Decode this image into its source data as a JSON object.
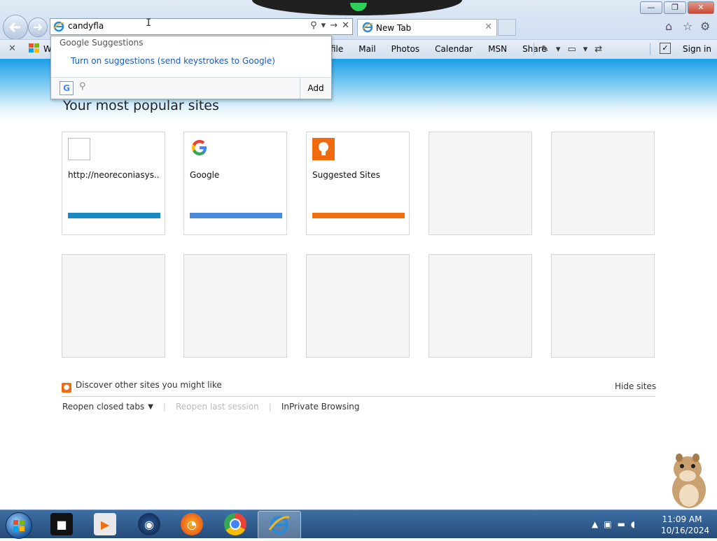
{
  "browser": {
    "address_value": "candyfla",
    "tab_label": "New Tab",
    "window_buttons": {
      "minimize": "—",
      "restore": "❐",
      "close": "✕"
    },
    "address_actions": {
      "search": "⚲",
      "dropdown": "▾",
      "go": "→",
      "stop": "✕"
    }
  },
  "favorites_bar": {
    "left_partial": "W",
    "links": [
      "file",
      "Mail",
      "Photos",
      "Calendar",
      "MSN",
      "Share"
    ],
    "sign_in": "Sign in"
  },
  "suggestions": {
    "header": "Google Suggestions",
    "turn_on_link": "Turn on suggestions (send keystrokes to Google)",
    "google_letter": "G",
    "add_button": "Add"
  },
  "page": {
    "title": "Your most popular sites",
    "tiles": [
      {
        "name": "http://neoreconiasys....",
        "bar_color": "#1a8ac4"
      },
      {
        "name": "Google",
        "bar_color": "#4a8be0"
      },
      {
        "name": "Suggested Sites",
        "bar_color": "#f07010"
      }
    ],
    "discover_text": "Discover other sites you might like",
    "hide_sites": "Hide sites",
    "reopen_closed_tabs": "Reopen closed tabs",
    "reopen_last_session": "Reopen last session",
    "inprivate": "InPrivate Browsing"
  },
  "taskbar": {
    "time": "11:09 AM",
    "date": "10/16/2024"
  }
}
